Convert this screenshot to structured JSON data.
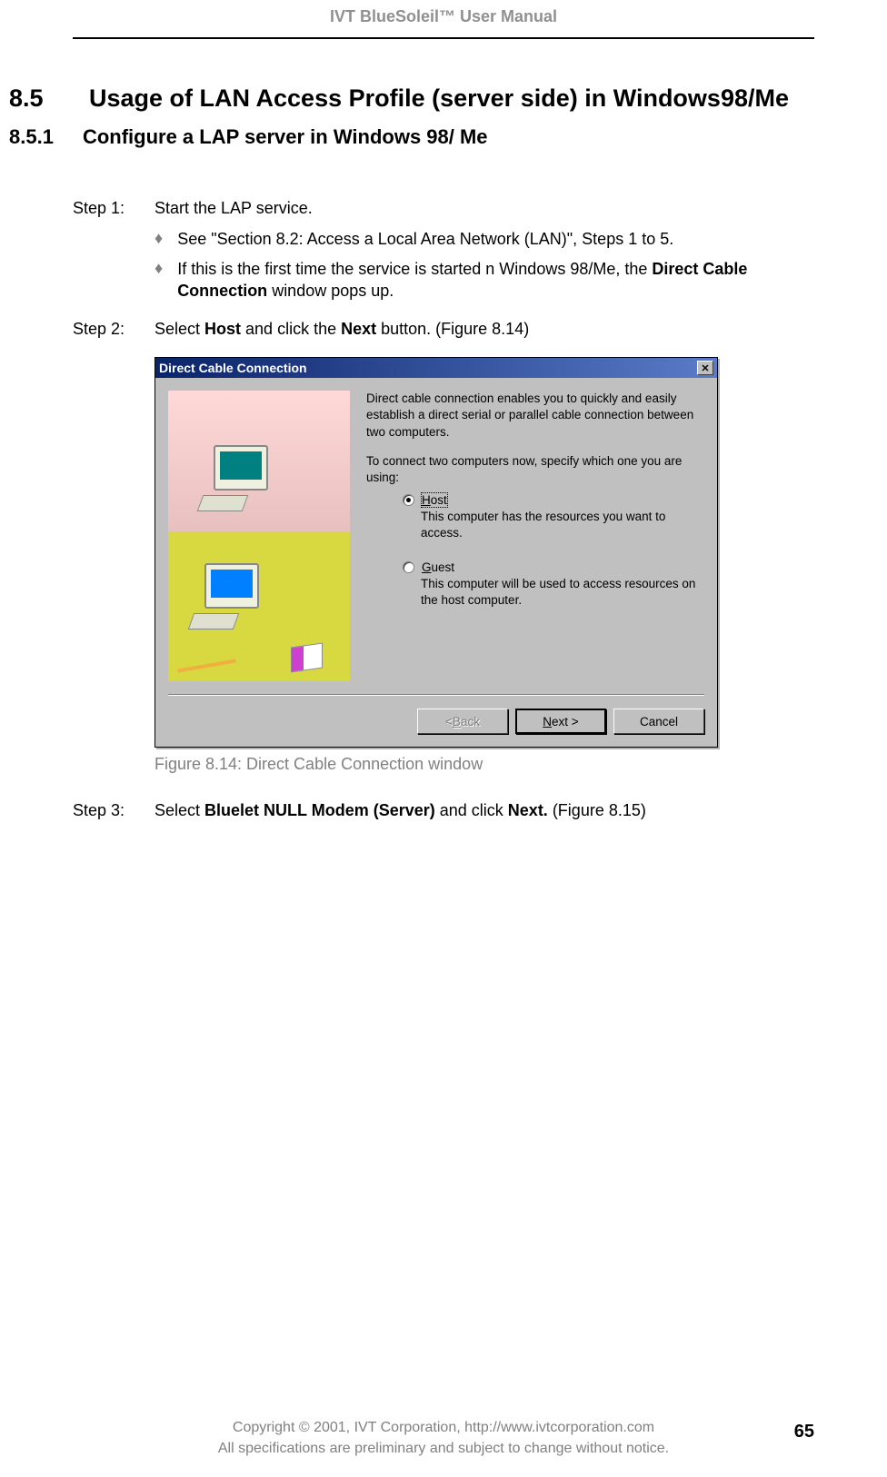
{
  "header": {
    "title": "IVT BlueSoleil™ User Manual"
  },
  "section": {
    "number": "8.5",
    "title": "Usage of LAN Access Profile (server side) in Windows98/Me"
  },
  "subsection": {
    "number": "8.5.1",
    "title": "Configure a LAP server in Windows 98/ Me"
  },
  "steps": {
    "step1": {
      "label": "Step 1:",
      "text": "Start the LAP service.",
      "bullets": [
        {
          "text": "See \"Section 8.2: Access a Local Area Network (LAN)\", Steps 1 to 5."
        },
        {
          "text_a": "If this is the first time the service is started n Windows 98/Me, the ",
          "bold": "Direct Cable Connection",
          "text_b": " window pops up."
        }
      ]
    },
    "step2": {
      "label": "Step 2:",
      "text_a": "Select ",
      "bold1": "Host",
      "text_b": " and click the ",
      "bold2": "Next",
      "text_c": " button. (Figure 8.14)"
    },
    "step3": {
      "label": "Step 3:",
      "text_a": "Select ",
      "bold1": "Bluelet NULL Modem (Server)",
      "text_b": " and click ",
      "bold2": "Next.",
      "text_c": " (Figure 8.15)"
    }
  },
  "dialog": {
    "title": "Direct Cable Connection",
    "close": "✕",
    "intro": "Direct cable connection enables you to quickly and easily establish a direct serial or parallel cable connection between two computers.",
    "prompt": "To connect two computers now, specify which one you are using:",
    "options": [
      {
        "accel": "H",
        "rest": "ost",
        "selected": true,
        "desc": "This computer has the resources you want to access."
      },
      {
        "accel": "G",
        "rest": "uest",
        "selected": false,
        "desc": "This computer will be used to access resources on the host computer."
      }
    ],
    "buttons": {
      "back": {
        "lt": "< ",
        "accel": "B",
        "rest": "ack"
      },
      "next": {
        "accel": "N",
        "rest": "ext >"
      },
      "cancel": "Cancel"
    }
  },
  "figure_caption": "Figure 8.14: Direct Cable Connection window",
  "footer": {
    "line1": "Copyright © 2001, IVT Corporation, http://www.ivtcorporation.com",
    "line2": "All specifications are preliminary and subject to change without notice.",
    "page_number": "65"
  }
}
